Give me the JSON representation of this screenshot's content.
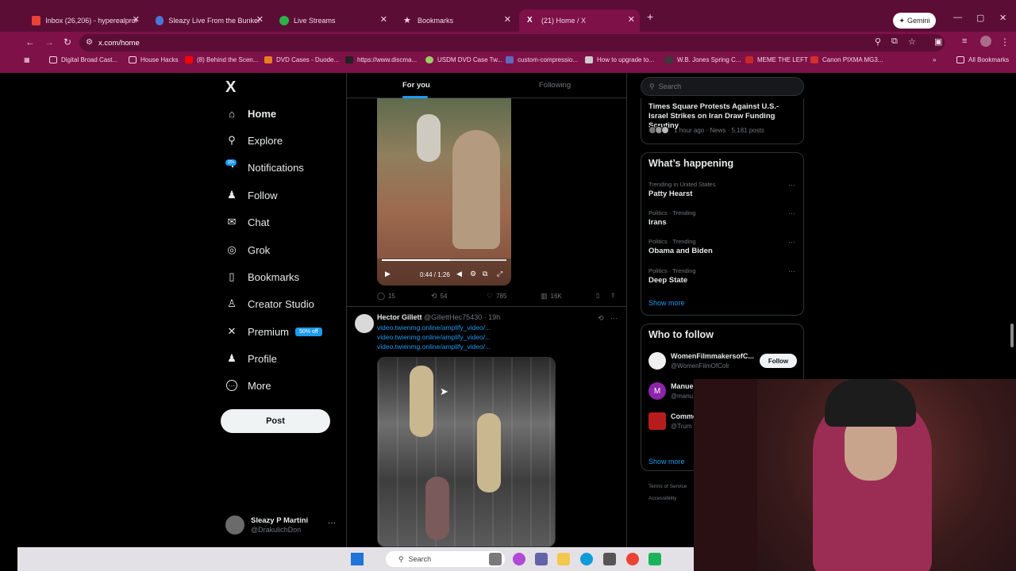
{
  "browser": {
    "tabs": [
      {
        "label": "Inbox (26,206) - hyperealprods",
        "color": "#ea4335"
      },
      {
        "label": "Sleazy Live From the Bunker 2/...",
        "color": "#4a76d8"
      },
      {
        "label": "Live Streams",
        "color": "#2bb14a"
      },
      {
        "label": "Bookmarks",
        "color": "#f3d9e6"
      },
      {
        "label": "(21) Home / X",
        "color": "#ffffff"
      }
    ],
    "new_tab": "+",
    "gemini_label": "Gemini",
    "url": "x.com/home",
    "bookmarks": [
      "Digital Broad Cast...",
      "House Hacks",
      "(8) Behind the Scen...",
      "DVD Cases - Duode...",
      "https://www.discma...",
      "USDM DVD Case Tw...",
      "custom-compressio...",
      "How to upgrade to...",
      "W.B. Jones Spring C...",
      "MEME THE LEFT",
      "Canon PIXMA MG3...",
      "All Bookmarks"
    ]
  },
  "nav": {
    "logo": "X",
    "items": [
      {
        "label": "Home",
        "icon": "home-icon",
        "glyph": "⌂"
      },
      {
        "label": "Explore",
        "icon": "search-icon",
        "glyph": "⚲"
      },
      {
        "label": "Notifications",
        "icon": "bell-icon",
        "glyph": "🔔"
      },
      {
        "label": "Follow",
        "icon": "follow-icon",
        "glyph": "👤"
      },
      {
        "label": "Chat",
        "icon": "mail-icon",
        "glyph": "✉"
      },
      {
        "label": "Grok",
        "icon": "grok-icon",
        "glyph": "◎"
      },
      {
        "label": "Bookmarks",
        "icon": "bookmark-icon",
        "glyph": "▯"
      },
      {
        "label": "Creator Studio",
        "icon": "creator-icon",
        "glyph": "♙"
      },
      {
        "label": "Premium",
        "icon": "x-icon",
        "glyph": "✕"
      },
      {
        "label": "Profile",
        "icon": "profile-icon",
        "glyph": "👤"
      },
      {
        "label": "More",
        "icon": "more-icon",
        "glyph": "⋯"
      }
    ],
    "notif_badge": "20+",
    "premium_badge": "50% off",
    "post_label": "Post",
    "profile_name": "Sleazy P Martini",
    "profile_handle": "@DrakulichDon",
    "more_glyph": "···"
  },
  "feed": {
    "tabs": [
      "For you",
      "Following"
    ],
    "tweet1": {
      "time": "0:44 / 1:26",
      "replies": "15",
      "reposts": "54",
      "likes": "785",
      "views": "16K"
    },
    "tweet2": {
      "name": "Hector Gillett",
      "handle": "@GillettHec75430 · 19h",
      "links": [
        "video.twienmg.online/amplify_video/...",
        "video.twienmg.online/amplify_video/...",
        "video.twienmg.online/amplify_video/..."
      ]
    }
  },
  "right": {
    "search_placeholder": "Search",
    "news_title": "Times Square Protests Against U.S.-Israel Strikes on Iran Draw Funding Scrutiny",
    "news_meta": "1 hour ago · News · 5,181 posts",
    "happening_title": "What’s happening",
    "trends": [
      {
        "category": "Trending in United States",
        "name": "Patty Hearst"
      },
      {
        "category": "Politics · Trending",
        "name": "Irans"
      },
      {
        "category": "Politics · Trending",
        "name": "Obama and Biden"
      },
      {
        "category": "Politics · Trending",
        "name": "Deep State"
      }
    ],
    "show_more": "Show more",
    "who_title": "Who to follow",
    "who": [
      {
        "name": "WomenFilmmakersofC...",
        "handle": "@WomenFilmOfColr",
        "color": "#f0f0f0"
      },
      {
        "name": "Manue",
        "handle": "@manu",
        "color": "#8e24aa"
      },
      {
        "name": "Comme",
        "handle": "@Trum",
        "color": "#b71c1c"
      }
    ],
    "follow_label": "Follow",
    "footer_links": [
      "Terms of Service",
      "Accessibility"
    ]
  },
  "taskbar": {
    "search_label": "Search"
  }
}
